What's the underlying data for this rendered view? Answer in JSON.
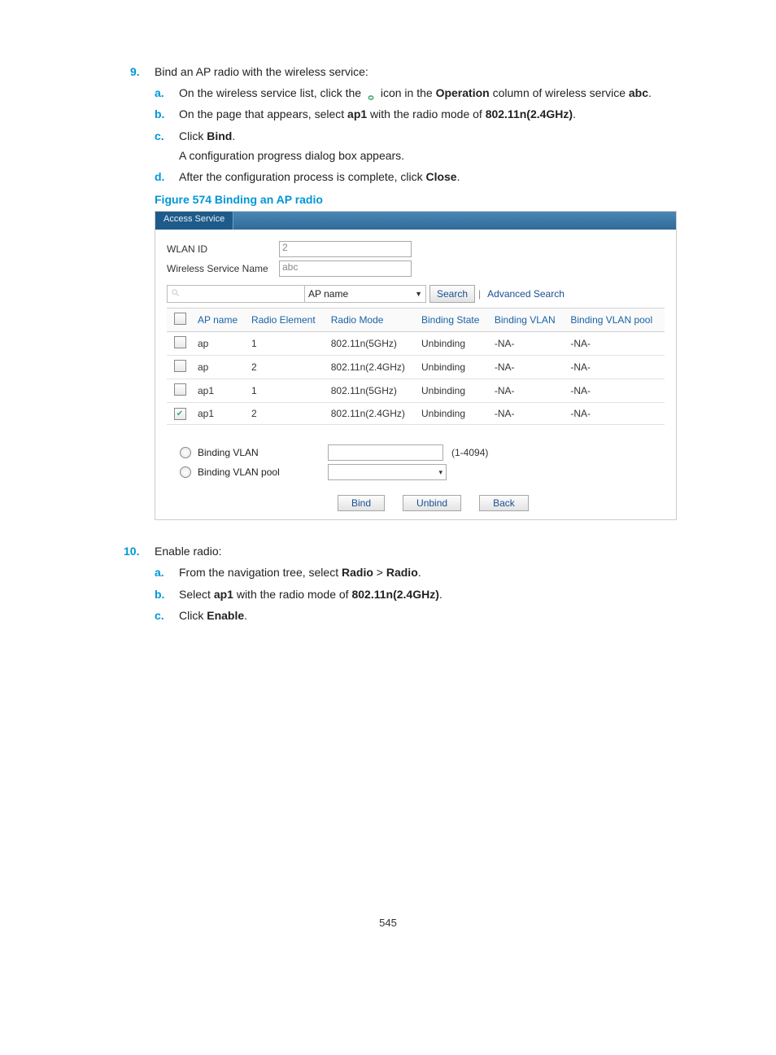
{
  "step9": {
    "number": "9.",
    "title": "Bind an AP radio with the wireless service:",
    "a_pre": "On the wireless service list, click the ",
    "a_mid": " icon in the ",
    "a_op": "Operation",
    "a_post": " column of wireless service ",
    "a_service": "abc",
    "a_end": ".",
    "b_pre": "On the page that appears, select ",
    "b_ap": "ap1",
    "b_mid": " with the radio mode of ",
    "b_mode": "802.11n(2.4GHz)",
    "b_end": ".",
    "c_pre": "Click ",
    "c_btn": "Bind",
    "c_end": ".",
    "c_note": "A configuration progress dialog box appears.",
    "d_pre": "After the configuration process is complete, click ",
    "d_btn": "Close",
    "d_end": "."
  },
  "figure": {
    "caption": "Figure 574 Binding an AP radio",
    "tab": "Access Service",
    "wlan_id_label": "WLAN ID",
    "wlan_id_value": "2",
    "service_name_label": "Wireless Service Name",
    "service_name_value": "abc",
    "search_field_option": "AP name",
    "search_btn": "Search",
    "adv_search": "Advanced Search",
    "headers": [
      "",
      "AP name",
      "Radio Element",
      "Radio Mode",
      "Binding State",
      "Binding VLAN",
      "Binding VLAN pool"
    ],
    "rows": [
      {
        "checked": false,
        "ap": "ap",
        "re": "1",
        "mode": "802.11n(5GHz)",
        "state": "Unbinding",
        "vlan": "-NA-",
        "pool": "-NA-"
      },
      {
        "checked": false,
        "ap": "ap",
        "re": "2",
        "mode": "802.11n(2.4GHz)",
        "state": "Unbinding",
        "vlan": "-NA-",
        "pool": "-NA-"
      },
      {
        "checked": false,
        "ap": "ap1",
        "re": "1",
        "mode": "802.11n(5GHz)",
        "state": "Unbinding",
        "vlan": "-NA-",
        "pool": "-NA-"
      },
      {
        "checked": true,
        "ap": "ap1",
        "re": "2",
        "mode": "802.11n(2.4GHz)",
        "state": "Unbinding",
        "vlan": "-NA-",
        "pool": "-NA-"
      }
    ],
    "bind_vlan_label": "Binding VLAN",
    "bind_pool_label": "Binding VLAN pool",
    "vlan_hint": "(1-4094)",
    "btn_bind": "Bind",
    "btn_unbind": "Unbind",
    "btn_back": "Back"
  },
  "step10": {
    "number": "10.",
    "title": "Enable radio:",
    "a_pre": "From the navigation tree, select ",
    "a_p1": "Radio",
    "a_gt": " > ",
    "a_p2": "Radio",
    "a_end": ".",
    "b_pre": "Select ",
    "b_ap": "ap1",
    "b_mid": " with the radio mode of ",
    "b_mode": "802.11n(2.4GHz)",
    "b_end": ".",
    "c_pre": "Click ",
    "c_btn": "Enable",
    "c_end": "."
  },
  "letters": {
    "a": "a.",
    "b": "b.",
    "c": "c.",
    "d": "d."
  },
  "page_number": "545"
}
